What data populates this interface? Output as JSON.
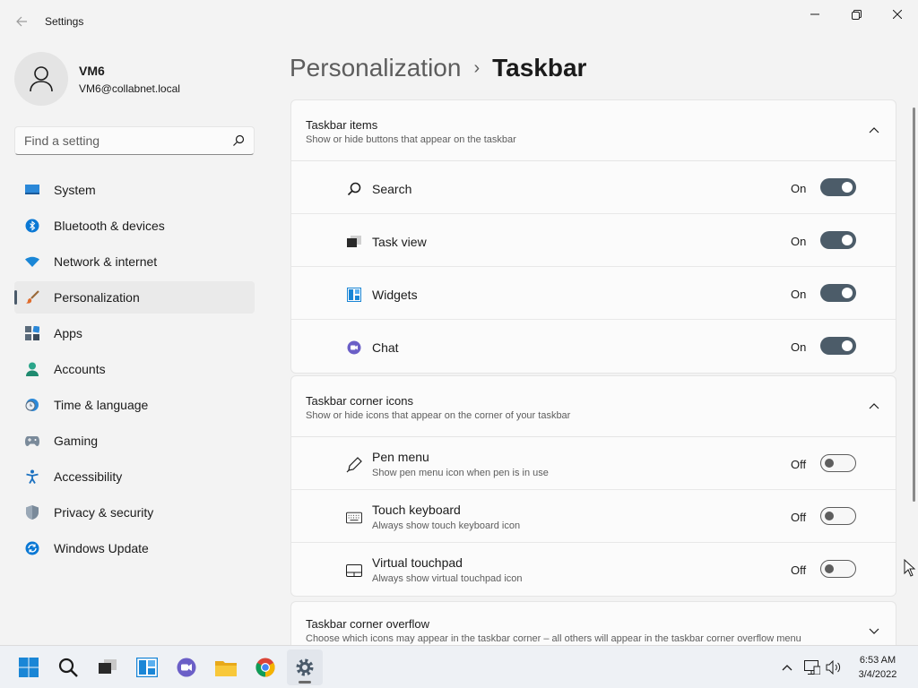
{
  "window": {
    "title": "Settings"
  },
  "profile": {
    "name": "VM6",
    "email": "VM6@collabnet.local"
  },
  "search": {
    "placeholder": "Find a setting"
  },
  "sidebar": {
    "items": [
      {
        "label": "System",
        "icon": "system-icon"
      },
      {
        "label": "Bluetooth & devices",
        "icon": "bluetooth-icon"
      },
      {
        "label": "Network & internet",
        "icon": "wifi-icon"
      },
      {
        "label": "Personalization",
        "icon": "brush-icon",
        "active": true
      },
      {
        "label": "Apps",
        "icon": "apps-icon"
      },
      {
        "label": "Accounts",
        "icon": "person-icon"
      },
      {
        "label": "Time & language",
        "icon": "clock-globe-icon"
      },
      {
        "label": "Gaming",
        "icon": "gamepad-icon"
      },
      {
        "label": "Accessibility",
        "icon": "accessibility-icon"
      },
      {
        "label": "Privacy & security",
        "icon": "shield-icon"
      },
      {
        "label": "Windows Update",
        "icon": "update-icon"
      }
    ]
  },
  "breadcrumb": {
    "parent": "Personalization",
    "separator": "›",
    "current": "Taskbar"
  },
  "taskbar_items": {
    "title": "Taskbar items",
    "subtitle": "Show or hide buttons that appear on the taskbar",
    "rows": [
      {
        "label": "Search",
        "state": "On",
        "icon": "search-icon"
      },
      {
        "label": "Task view",
        "state": "On",
        "icon": "task-view-icon"
      },
      {
        "label": "Widgets",
        "state": "On",
        "icon": "widgets-icon"
      },
      {
        "label": "Chat",
        "state": "On",
        "icon": "chat-icon"
      }
    ]
  },
  "corner_icons": {
    "title": "Taskbar corner icons",
    "subtitle": "Show or hide icons that appear on the corner of your taskbar",
    "rows": [
      {
        "label": "Pen menu",
        "sub": "Show pen menu icon when pen is in use",
        "state": "Off",
        "icon": "pen-icon"
      },
      {
        "label": "Touch keyboard",
        "sub": "Always show touch keyboard icon",
        "state": "Off",
        "icon": "keyboard-icon"
      },
      {
        "label": "Virtual touchpad",
        "sub": "Always show virtual touchpad icon",
        "state": "Off",
        "icon": "touchpad-icon"
      }
    ]
  },
  "corner_overflow": {
    "title": "Taskbar corner overflow",
    "subtitle": "Choose which icons may appear in the taskbar corner – all others will appear in the taskbar corner overflow menu"
  },
  "taskbar": {
    "time": "6:53 AM",
    "date": "3/4/2022"
  },
  "colors": {
    "toggle_on": "#4c5c69",
    "accent": "#0067c0"
  }
}
